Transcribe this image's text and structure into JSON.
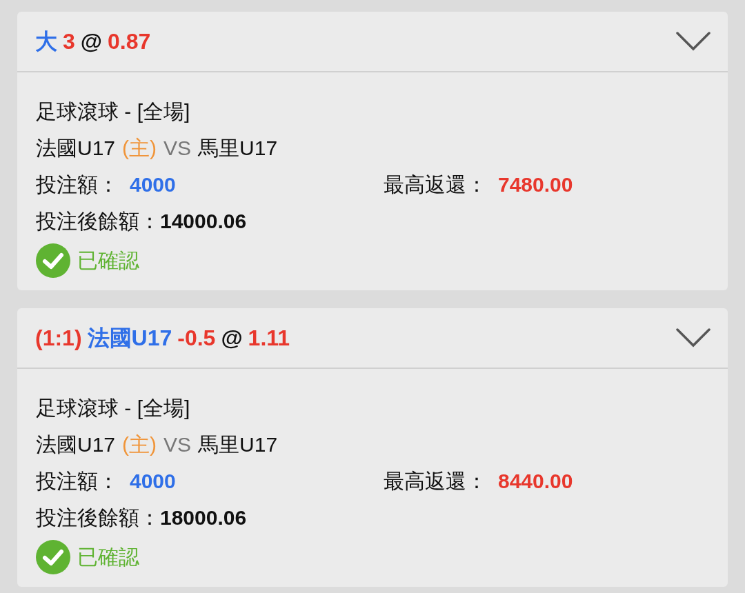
{
  "bets": [
    {
      "title": [
        {
          "text": "大",
          "color": "#2f6fe8"
        },
        {
          "text": "3",
          "color": "#e8372c"
        },
        {
          "text": "@",
          "color": "#111111"
        },
        {
          "text": "0.87",
          "color": "#e8372c"
        }
      ],
      "market": "足球滾球 - [全場]",
      "home": "法國U17",
      "home_tag": "(主)",
      "vs": "VS",
      "away": "馬里U17",
      "stake_label": "投注額：",
      "stake": "4000",
      "return_label": "最高返還：",
      "return": "7480.00",
      "balance_label": "投注後餘額：",
      "balance": "14000.06",
      "status": "已確認"
    },
    {
      "title": [
        {
          "text": "(1:1)",
          "color": "#e8372c"
        },
        {
          "text": "法國U17",
          "color": "#2f6fe8"
        },
        {
          "text": "-0.5",
          "color": "#e8372c"
        },
        {
          "text": "@",
          "color": "#111111"
        },
        {
          "text": "1.11",
          "color": "#e8372c"
        }
      ],
      "market": "足球滾球 - [全場]",
      "home": "法國U17",
      "home_tag": "(主)",
      "vs": "VS",
      "away": "馬里U17",
      "stake_label": "投注額：",
      "stake": "4000",
      "return_label": "最高返還：",
      "return": "8440.00",
      "balance_label": "投注後餘額：",
      "balance": "18000.06",
      "status": "已確認"
    }
  ]
}
